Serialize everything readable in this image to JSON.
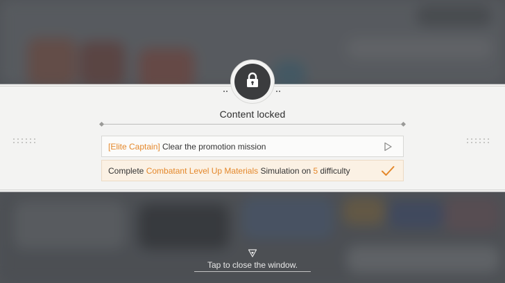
{
  "dialog": {
    "title": "Content locked",
    "lock_icon": "padlock-icon"
  },
  "requirements": [
    {
      "tag": "[Elite Captain]",
      "text": " Clear the promotion mission",
      "status_icon": "play-outline-icon"
    },
    {
      "prefix": "Complete ",
      "material": "Combatant Level Up Materials",
      "middle": " Simulation on ",
      "difficulty": "5",
      "suffix": " difficulty",
      "status_icon": "checkmark-icon"
    }
  ],
  "footer": {
    "close_hint": "Tap to close the window.",
    "close_icon": "down-triangle-icon"
  },
  "colors": {
    "highlight": "#e4872a",
    "panel": "#f3f3f2",
    "badge": "#3b3c3e",
    "completed_row": "#fbf1e4"
  }
}
